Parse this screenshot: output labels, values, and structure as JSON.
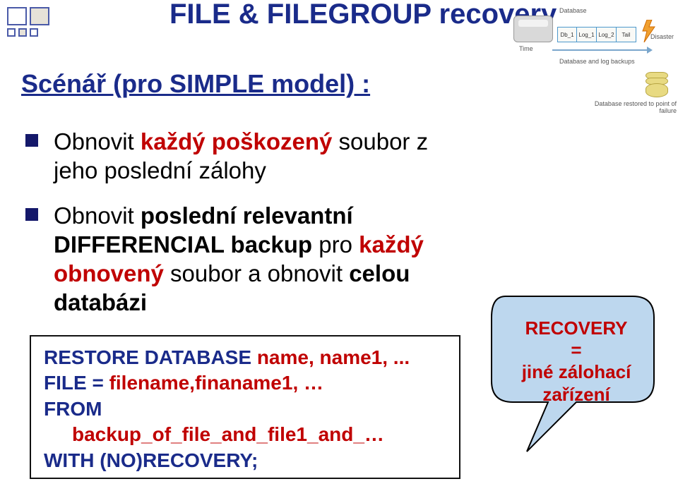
{
  "title": "FILE & FILEGROUP recovery",
  "subtitle": "Scénář (pro SIMPLE model) :",
  "bullets": [
    {
      "prefix": "Obnovit ",
      "red": "každý poškozený",
      "suffix": " soubor z jeho poslední zálohy"
    },
    {
      "prefix": "Obnovit ",
      "bold": "poslední relevantní DIFFERENCIAL backup",
      "mid": " pro ",
      "red": "každý obnovený",
      "suffix2": " soubor a obnovit ",
      "bold2": "celou databázi"
    }
  ],
  "code": {
    "l1_kw": "RESTORE DATABASE ",
    "l1_arg": "name, name1, ...",
    "l2_kw": "FILE = ",
    "l2_arg": "filename,finaname1, …",
    "l3_kw": "FROM",
    "l4_arg": "backup_of_file_and_file1_and_…",
    "l5_kw": "WITH (NO)RECOVERY;"
  },
  "bubble": {
    "line1": "RECOVERY",
    "line2": "=",
    "line3": "jiné zálohací",
    "line4": "zařízení"
  },
  "diagram": {
    "segs": [
      "Db_1",
      "Log_1",
      "Log_2",
      "Tail"
    ],
    "label_database": "Database",
    "label_time": "Time",
    "label_disaster": "Disaster",
    "label_backups": "Database and log backups",
    "label_restore": "Database restored to point of failure"
  }
}
